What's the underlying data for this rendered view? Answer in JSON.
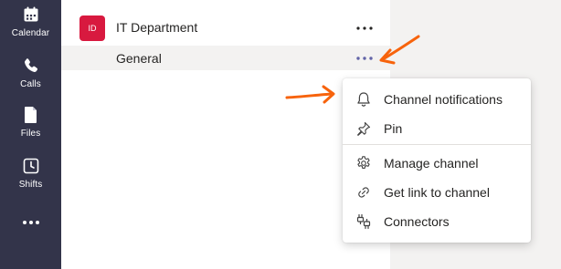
{
  "rail": {
    "items": [
      {
        "label": "Calendar",
        "icon": "calendar-icon"
      },
      {
        "label": "Calls",
        "icon": "phone-icon"
      },
      {
        "label": "Files",
        "icon": "file-icon"
      },
      {
        "label": "Shifts",
        "icon": "clock-icon"
      }
    ],
    "more_icon": "more-icon"
  },
  "team": {
    "avatar_initials": "ID",
    "name": "IT Department",
    "avatar_color": "#d8193f"
  },
  "channel": {
    "name": "General",
    "more_icon_color": "#6264a7"
  },
  "menu": {
    "items": [
      {
        "label": "Channel notifications",
        "icon": "bell-icon"
      },
      {
        "label": "Pin",
        "icon": "pin-icon"
      },
      {
        "label": "Manage channel",
        "icon": "gear-icon"
      },
      {
        "label": "Get link to channel",
        "icon": "link-icon"
      },
      {
        "label": "Connectors",
        "icon": "connectors-icon"
      }
    ]
  },
  "annotations": {
    "arrow_color": "#f7630c"
  }
}
